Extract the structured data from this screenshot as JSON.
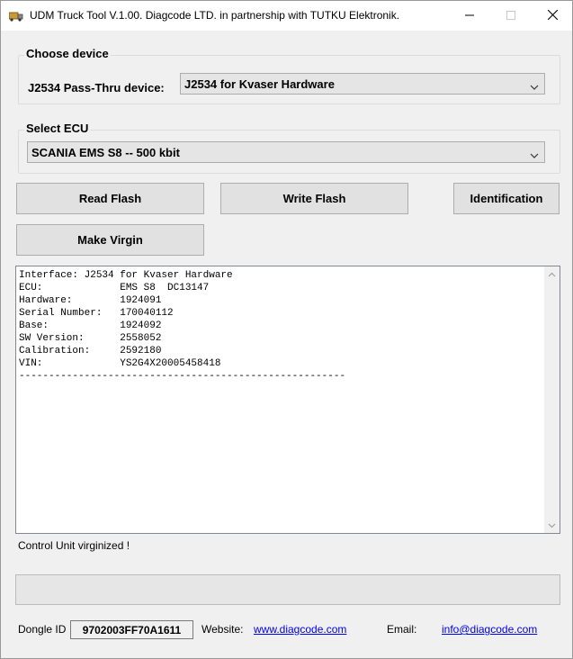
{
  "window": {
    "title": "UDM Truck Tool V.1.00. Diagcode LTD. in partnership with TUTKU Elektronik.",
    "icons": {
      "app": "truck-icon",
      "minimize": "minimize-icon",
      "maximize": "maximize-icon",
      "close": "close-icon"
    }
  },
  "device_group": {
    "title": "Choose device",
    "label": "J2534 Pass-Thru device:",
    "selected": "J2534 for Kvaser Hardware"
  },
  "ecu_group": {
    "title": "Select ECU",
    "selected": "SCANIA EMS S8 -- 500 kbit"
  },
  "buttons": {
    "read_flash": "Read Flash",
    "write_flash": "Write Flash",
    "identification": "Identification",
    "make_virgin": "Make Virgin"
  },
  "log": {
    "lines": "Interface: J2534 for Kvaser Hardware\nECU:             EMS S8  DC13147\nHardware:        1924091\nSerial Number:   170040112\nBase:            1924092\nSW Version:      2558052\nCalibration:     2592180\nVIN:             YS2G4X20005458418\n-------------------------------------------------------"
  },
  "status": {
    "message": "Control Unit virginized !"
  },
  "progress": {
    "value": 0
  },
  "footer": {
    "dongle_label": "Dongle ID",
    "dongle_id": "9702003FF70A1611",
    "website_label": "Website:",
    "website": "www.diagcode.com",
    "email_label": "Email:",
    "email": "info@diagcode.com"
  }
}
